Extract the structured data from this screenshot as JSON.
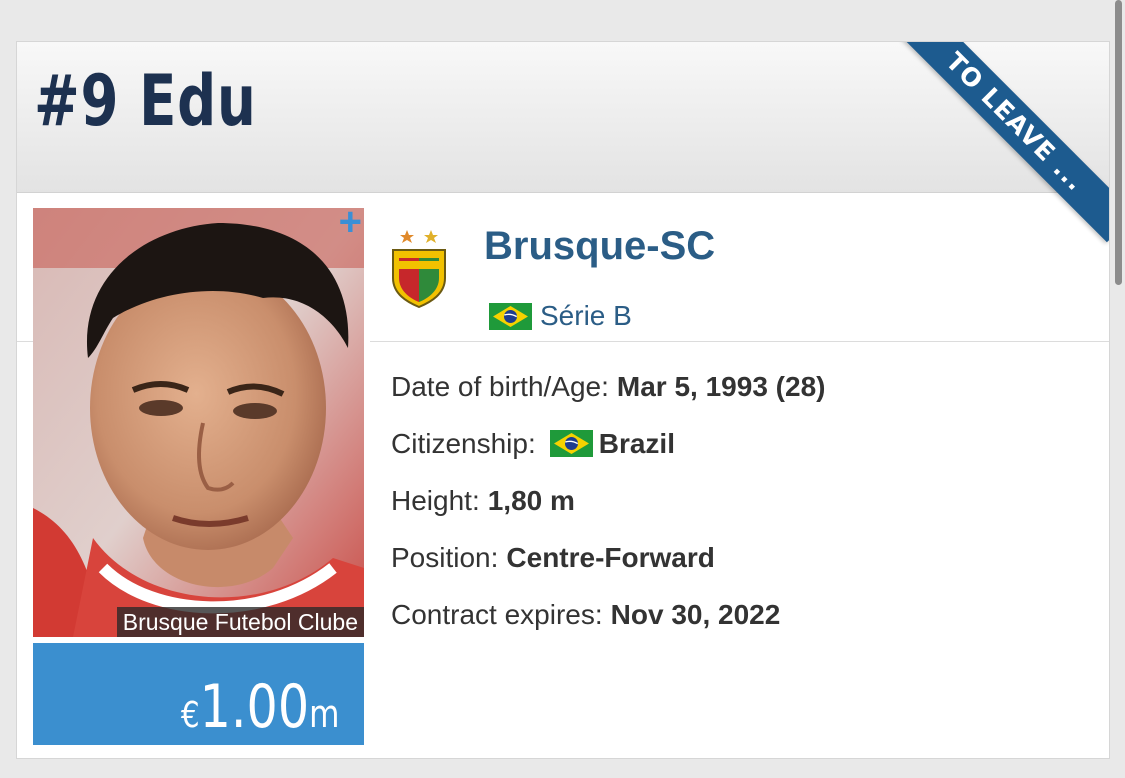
{
  "player": {
    "title": "#9 Edu",
    "status_ribbon": "TO LEAVE ..."
  },
  "photo": {
    "caption": "Brusque Futebol Clube",
    "plus_label": "+"
  },
  "market_value": {
    "currency": "€",
    "amount": "1.00",
    "unit": "m"
  },
  "club": {
    "name": "Brusque-SC",
    "crest_icon": "brusque-crest-icon",
    "league": {
      "name": "Série B",
      "flag_icon": "brazil-flag-icon"
    }
  },
  "details": [
    {
      "label": "Date of birth/Age:",
      "value": "Mar 5, 1993 (28)"
    },
    {
      "label": "Citizenship:",
      "value": "Brazil",
      "flag_icon": "brazil-flag-icon"
    },
    {
      "label": "Height:",
      "value": "1,80 m"
    },
    {
      "label": "Position:",
      "value": "Centre-Forward"
    },
    {
      "label": "Contract expires:",
      "value": "Nov 30, 2022"
    }
  ],
  "colors": {
    "title": "#1d3150",
    "ribbon": "#1d5b8f",
    "link": "#2b5d86",
    "value_box": "#3b8fcf"
  }
}
